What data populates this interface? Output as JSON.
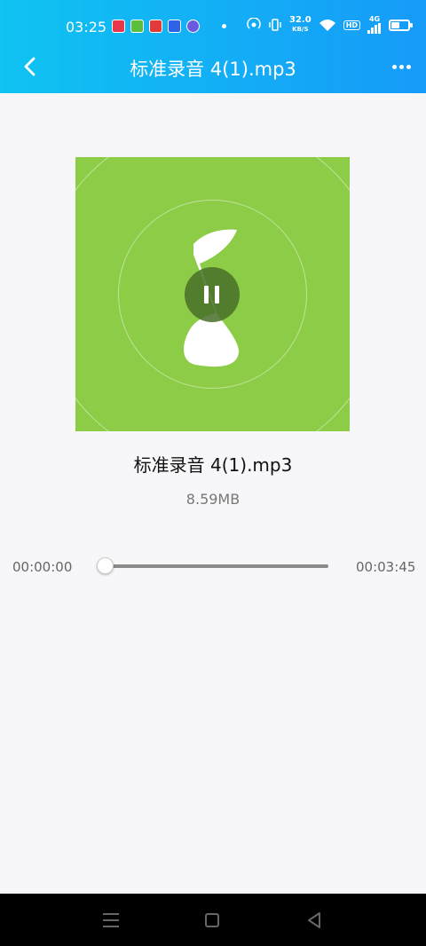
{
  "status_bar": {
    "time": "03:25",
    "net_speed_value": "32.0",
    "net_speed_unit": "KB/S",
    "hd_badge": "HD",
    "network_type": "4G",
    "battery_percent": 45
  },
  "header": {
    "title": "标准录音 4(1).mp3",
    "back_icon": "chevron-left-icon",
    "more_icon": "more-horizontal-icon"
  },
  "player": {
    "cover_color": "#8dcc47",
    "state_icon": "pause-icon",
    "song_name": "标准录音 4(1).mp3",
    "file_size": "8.59MB",
    "current_time": "00:00:00",
    "total_time": "00:03:45",
    "progress_fraction": 0
  },
  "nav_bar": {
    "menu_icon": "menu-icon",
    "home_icon": "home-square-icon",
    "back_icon": "back-triangle-icon"
  }
}
